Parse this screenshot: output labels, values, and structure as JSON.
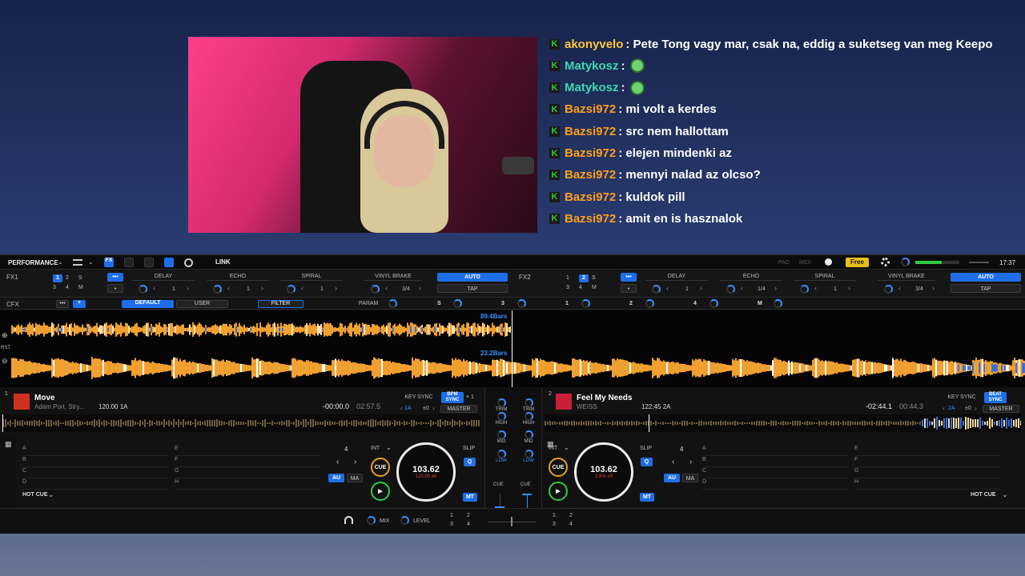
{
  "chat": {
    "messages": [
      {
        "user": "akonyvelo",
        "color": "#ffc83d",
        "text": ": Pete Tong vagy mar, csak na, eddig a suketseg van meg Keepo",
        "emote": false
      },
      {
        "user": "Matykosz",
        "color": "#3ed8b0",
        "text": ":",
        "emote": true
      },
      {
        "user": "Matykosz",
        "color": "#3ed8b0",
        "text": ":",
        "emote": true
      },
      {
        "user": "Bazsi972",
        "color": "#ff9f1c",
        "text": ": mi volt a kerdes",
        "emote": false
      },
      {
        "user": "Bazsi972",
        "color": "#ff9f1c",
        "text": ": src nem hallottam",
        "emote": false
      },
      {
        "user": "Bazsi972",
        "color": "#ff9f1c",
        "text": ": elejen mindenki az",
        "emote": false
      },
      {
        "user": "Bazsi972",
        "color": "#ff9f1c",
        "text": ": mennyi nalad az olcso?",
        "emote": false
      },
      {
        "user": "Bazsi972",
        "color": "#ff9f1c",
        "text": ": kuldok pill",
        "emote": false
      },
      {
        "user": "Bazsi972",
        "color": "#ff9f1c",
        "text": ": amit en is hasznalok",
        "emote": false
      }
    ],
    "badge_glyph": "K"
  },
  "toolbar": {
    "mode": "PERFORMANCE",
    "link": "LINK",
    "pad": "PAD",
    "midi": "MIDI",
    "free": "Free",
    "time": "17:37"
  },
  "fx1": {
    "label": "FX1",
    "slots": [
      "1",
      "2",
      "S",
      "3",
      "4",
      "M"
    ],
    "more": "•••",
    "dot": "•",
    "effects": [
      "DELAY",
      "ECHO",
      "SPIRAL",
      "VINYL BRAKE"
    ],
    "beats": [
      "1",
      "1",
      "1",
      "3/4"
    ],
    "auto": "AUTO",
    "tap": "TAP"
  },
  "fx2": {
    "label": "FX2",
    "slots": [
      "1",
      "2",
      "S",
      "3",
      "4",
      "M"
    ],
    "more": "•••",
    "dot": "•",
    "effects": [
      "DELAY",
      "ECHO",
      "SPIRAL",
      "VINYL BRAKE"
    ],
    "beats": [
      "1",
      "1/4",
      "1",
      "3/4"
    ],
    "auto": "AUTO",
    "tap": "TAP"
  },
  "cfx": {
    "label": "CFX",
    "more": "•••",
    "plus": "+",
    "default": "DEFAULT",
    "user": "USER",
    "filter": "FILTER",
    "param": "PARAM",
    "slots": [
      "S",
      "3",
      "1",
      "2",
      "4",
      "M"
    ]
  },
  "overview": {
    "bars_top": "89.4Bars",
    "bars_bottom": "23.2Bars",
    "rst": "RST"
  },
  "deck1": {
    "num": "1",
    "title": "Move",
    "artist": "Adam Port, Stry...",
    "bpm_key": "120.00  1A",
    "elapsed": "-00:00.0",
    "remaining": "02:57.5",
    "key_sync": "KEY SYNC",
    "key": "1A",
    "key_offset": "±0",
    "bpm_sync": "BPM SYNC",
    "multiplier": "× 1",
    "master": "MASTER",
    "beat_jump": "4",
    "int": "INT",
    "cue": "CUE",
    "play": "▶",
    "au": "AU",
    "ma": "MA",
    "slip": "SLIP",
    "q": "Q",
    "mt": "MT",
    "jog_bpm": "103.62",
    "jog_sub": "120.00  ±0",
    "hot_cue": "HOT CUE",
    "pads": [
      "A",
      "B",
      "C",
      "D",
      "E",
      "F",
      "G",
      "H"
    ],
    "progress": 0.0
  },
  "deck2": {
    "num": "2",
    "title": "Feel My Needs",
    "artist": "WEISS",
    "bpm_key": "122.45  2A",
    "elapsed": "-02:44.1",
    "remaining": "00:44.3",
    "key_sync": "KEY SYNC",
    "key": "2A",
    "key_offset": "±0",
    "beat_sync": "BEAT SYNC",
    "master": "MASTER",
    "beat_jump": "4",
    "int": "INT",
    "cue": "CUE",
    "play": "▶",
    "au": "AU",
    "ma": "MA",
    "slip": "SLIP",
    "q": "Q",
    "mt": "MT",
    "jog_bpm": "103.62",
    "jog_sub": "2.8%  ±0",
    "hot_cue": "HOT CUE",
    "pads": [
      "A",
      "B",
      "C",
      "D",
      "E",
      "F",
      "G",
      "H"
    ],
    "progress": 0.79
  },
  "mixer": {
    "trim": "TRIM",
    "high": "HIGH",
    "mid": "MID",
    "low": "LOW",
    "cue": "CUE",
    "mix": "MIX",
    "level": "LEVEL",
    "nums": [
      "1",
      "2",
      "3",
      "4"
    ]
  },
  "colors": {
    "accent": "#1e6ee8",
    "wave_orange": "#f0a030",
    "wave_blue": "#3a6ed8",
    "free_badge": "#e8c018"
  }
}
